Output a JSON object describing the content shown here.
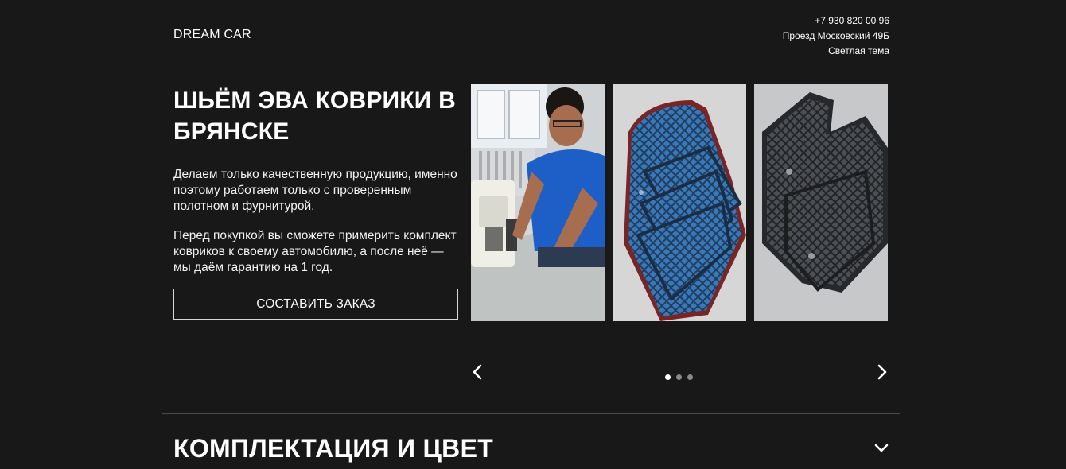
{
  "header": {
    "brand": "DREAM CAR",
    "phone": "+7 930 820 00 96",
    "address": "Проезд Московский 49Б",
    "theme_toggle": "Светлая тема"
  },
  "hero": {
    "title": "ШЬЁМ ЭВА КОВРИКИ В БРЯНСКЕ",
    "paragraph1": "Делаем только качественную продукцию, именно поэтому работаем только с проверенным полотном и фурнитурой.",
    "paragraph2": "Перед покупкой вы сможете примерить комплект ковриков к своему автомобилю, а после неё — мы даём гарантию на 1 год.",
    "order_button": "СОСТАВИТЬ ЗАКАЗ"
  },
  "gallery": {
    "images": [
      {
        "icon": "photo-sewing-worker"
      },
      {
        "icon": "photo-blue-eva-mats"
      },
      {
        "icon": "photo-gray-eva-mats"
      }
    ],
    "prev_icon": "chevron-left-icon",
    "next_icon": "chevron-right-icon",
    "dots_total": 3,
    "active_dot": 1
  },
  "accordion": {
    "title": "КОМПЛЕКТАЦИЯ И ЦВЕТ",
    "toggle_icon": "chevron-down-icon"
  },
  "colors": {
    "background": "#181818",
    "text": "#ffffff",
    "button_border": "#d8d8d8",
    "divider": "#4a4a4a",
    "dot_inactive": "#8a8a8a"
  }
}
